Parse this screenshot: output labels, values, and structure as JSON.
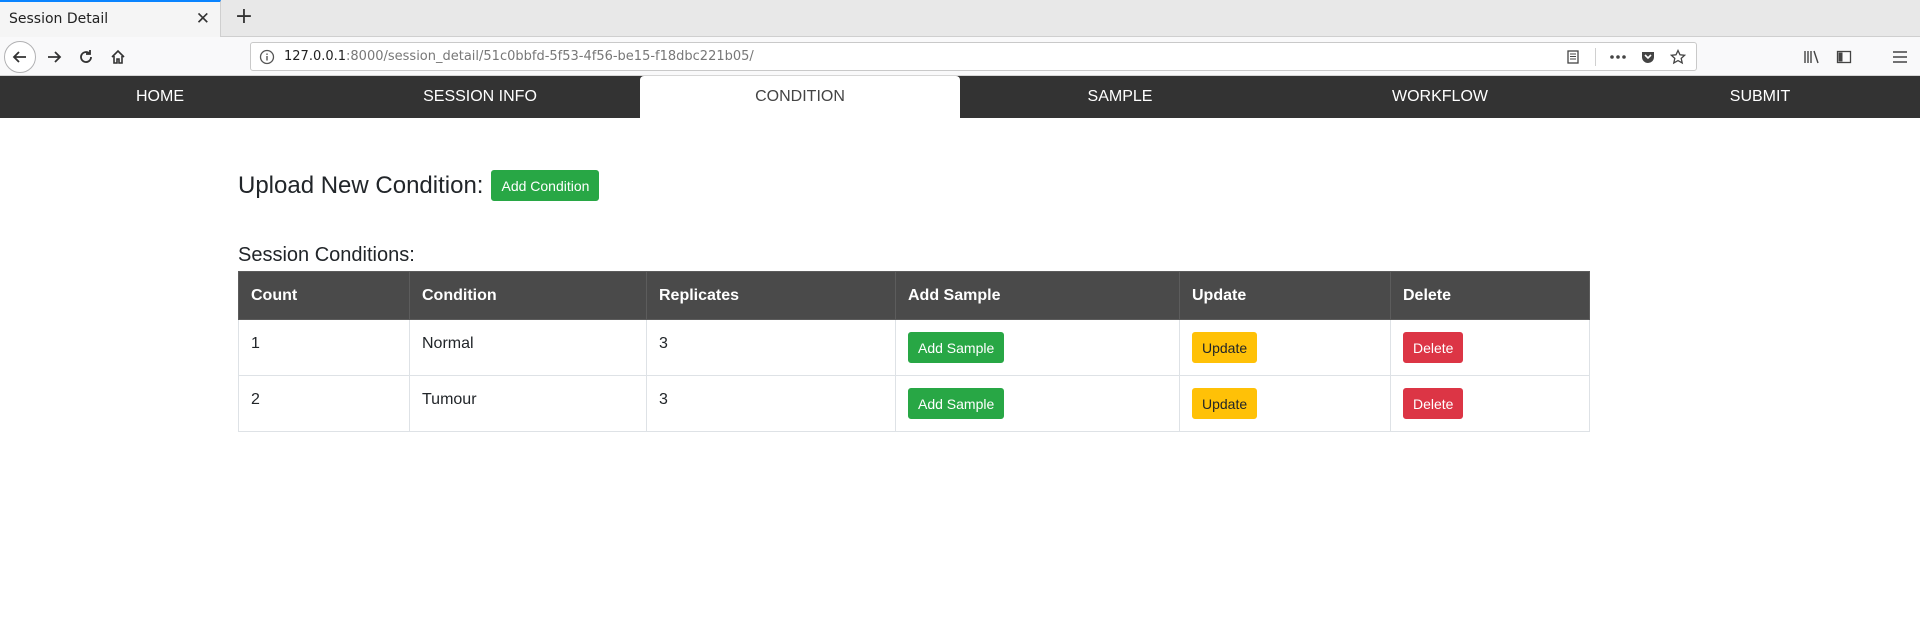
{
  "browser": {
    "tab_title": "Session Detail",
    "url_host": "127.0.0.1",
    "url_path": ":8000/session_detail/51c0bbfd-5f53-4f56-be15-f18dbc221b05/"
  },
  "sitenav": {
    "items": [
      {
        "label": "HOME"
      },
      {
        "label": "SESSION INFO"
      },
      {
        "label": "CONDITION"
      },
      {
        "label": "SAMPLE"
      },
      {
        "label": "WORKFLOW"
      },
      {
        "label": "SUBMIT"
      }
    ],
    "active": "CONDITION"
  },
  "upload": {
    "title": "Upload New Condition:",
    "button_label": "Add Condition"
  },
  "session_conditions": {
    "title": "Session Conditions:",
    "columns": [
      "Count",
      "Condition",
      "Replicates",
      "Add Sample",
      "Update",
      "Delete"
    ],
    "rows": [
      {
        "count": "1",
        "condition": "Normal",
        "replicates": "3",
        "add_sample": "Add Sample",
        "update": "Update",
        "delete": "Delete"
      },
      {
        "count": "2",
        "condition": "Tumour",
        "replicates": "3",
        "add_sample": "Add Sample",
        "update": "Update",
        "delete": "Delete"
      }
    ]
  },
  "colors": {
    "nav_bg": "#333333",
    "success": "#28a745",
    "warning": "#ffc107",
    "danger": "#dc3545",
    "table_header": "#4a4a4a"
  }
}
